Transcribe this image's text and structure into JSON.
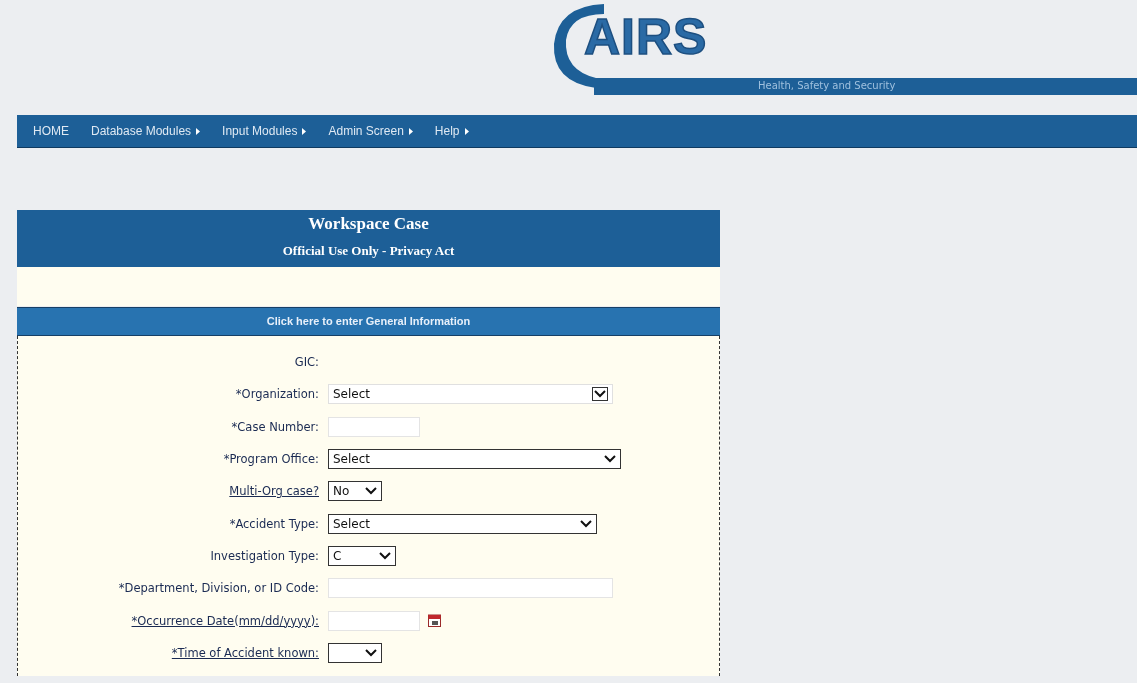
{
  "logo": {
    "text": "AIRS",
    "tagline": "Health, Safety and Security"
  },
  "nav": [
    {
      "label": "HOME",
      "submenu": false
    },
    {
      "label": "Database Modules",
      "submenu": true
    },
    {
      "label": "Input Modules",
      "submenu": true
    },
    {
      "label": "Admin Screen",
      "submenu": true
    },
    {
      "label": "Help",
      "submenu": true
    }
  ],
  "panel": {
    "title": "Workspace Case",
    "subtitle": "Official Use Only - Privacy Act"
  },
  "section": {
    "title": "Click here to enter General Information"
  },
  "fields": [
    {
      "kind": "none",
      "label": "GIC:",
      "link": false
    },
    {
      "kind": "select",
      "label": "*Organization:",
      "link": false,
      "value": "Select"
    },
    {
      "kind": "text",
      "label": "*Case Number:",
      "link": false
    },
    {
      "kind": "select",
      "label": "*Program Office:",
      "link": false,
      "value": "Select"
    },
    {
      "kind": "select",
      "label": "Multi-Org case?",
      "link": true,
      "value": "No"
    },
    {
      "kind": "select",
      "label": "*Accident Type:",
      "link": false,
      "value": "Select"
    },
    {
      "kind": "select",
      "label": "Investigation Type:",
      "link": false,
      "value": "C"
    },
    {
      "kind": "text",
      "label": "*Department, Division, or ID Code:",
      "link": false
    },
    {
      "kind": "date",
      "label": "*Occurrence Date(mm/dd/yyyy):",
      "link": true
    },
    {
      "kind": "select",
      "label": "*Time of Accident known:",
      "link": true
    }
  ]
}
